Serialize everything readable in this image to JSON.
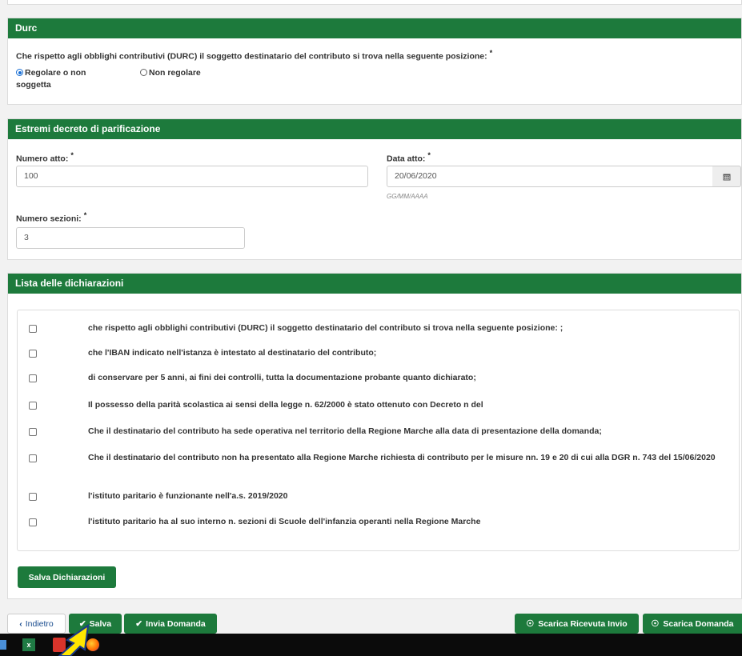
{
  "durc": {
    "title": "Durc",
    "question": "Che rispetto agli obblighi contributivi (DURC) il soggetto destinatario del contributo si trova nella seguente posizione:",
    "required_mark": "*",
    "options": [
      {
        "label_line1": "Regolare o non",
        "label_line2": "soggetta",
        "selected": true
      },
      {
        "label": "Non regolare",
        "selected": false
      }
    ]
  },
  "decreto": {
    "title": "Estremi decreto di parificazione",
    "numero_atto": {
      "label": "Numero atto:",
      "value": "100"
    },
    "data_atto": {
      "label": "Data atto:",
      "value": "20/06/2020",
      "hint": "GG/MM/AAAA",
      "icon": "calendar-icon"
    },
    "numero_sezioni": {
      "label": "Numero sezioni:",
      "value": "3"
    },
    "required_mark": "*"
  },
  "dichiarazioni": {
    "title": "Lista delle dichiarazioni",
    "items": [
      {
        "text": "che rispetto agli obblighi contributivi (DURC) il soggetto destinatario del contributo si trova nella seguente posizione: ;",
        "checked": false
      },
      {
        "text": "che l'IBAN indicato nell'istanza è intestato al destinatario del contributo;",
        "checked": false
      },
      {
        "text": "di conservare per 5 anni, ai fini dei controlli, tutta la documentazione probante quanto dichiarato;",
        "checked": false
      },
      {
        "text": "Il possesso della parità scolastica ai sensi della legge n. 62/2000 è stato ottenuto con Decreto n del",
        "checked": false
      },
      {
        "text": "Che il destinatario del contributo ha sede operativa nel territorio della Regione Marche alla data di presentazione della domanda;",
        "checked": false
      },
      {
        "text": "Che il destinatario del contributo non ha presentato alla Regione Marche richiesta di contributo per le misure nn. 19 e 20 di cui alla DGR n. 743 del 15/06/2020",
        "checked": false
      },
      {
        "text": "l'istituto paritario è funzionante nell'a.s. 2019/2020",
        "checked": false
      },
      {
        "text": "l'istituto paritario ha al suo interno n. sezioni di Scuole dell'infanzia operanti nella Regione Marche",
        "checked": false
      }
    ],
    "save_button": "Salva Dichiarazioni"
  },
  "footer": {
    "back": "Indietro",
    "save": "Salva",
    "send": "Invia Domanda",
    "download_receipt": "Scarica Ricevuta Invio",
    "download_application": "Scarica Domanda"
  },
  "colors": {
    "primary": "#1d7a3c",
    "radio_selected": "#1a6fd4",
    "link": "#1a4d8f"
  },
  "taskbar": {
    "icons": [
      "windows-icon",
      "excel-icon",
      "pdf-icon",
      "firefox-icon"
    ]
  }
}
